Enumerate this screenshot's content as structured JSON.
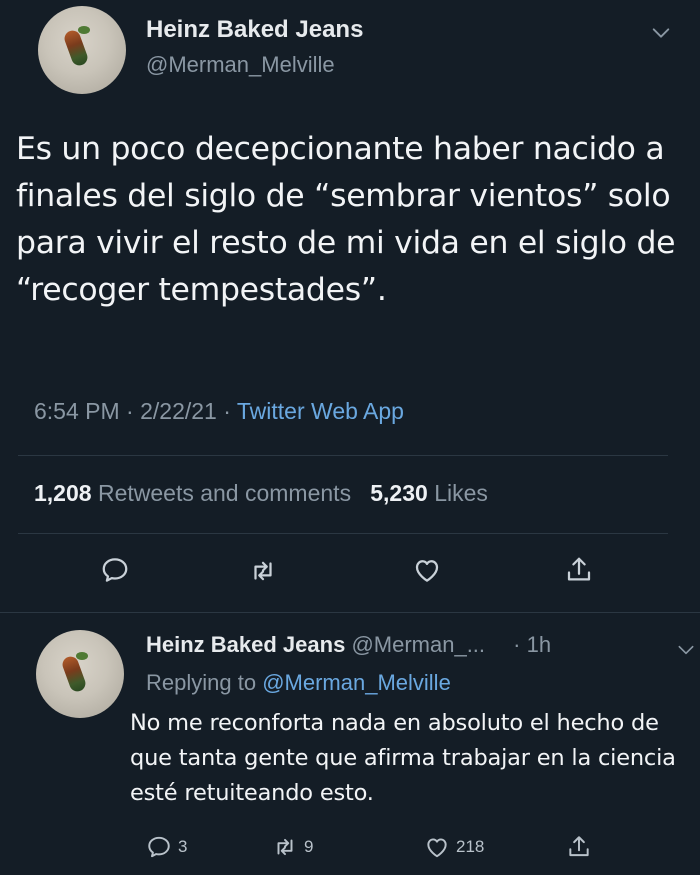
{
  "main_tweet": {
    "display_name": "Heinz Baked Jeans",
    "handle": "@Merman_Melville",
    "text": "Es un poco decepcionante haber nacido a finales del siglo de “sembrar vientos” solo para vivir el resto de mi vida en el siglo de “recoger tempestades”.",
    "time": "6:54 PM",
    "date": "2/22/21",
    "separator": "·",
    "source": "Twitter Web App",
    "retweets_count": "1,208",
    "retweets_label": "Retweets and comments",
    "likes_count": "5,230",
    "likes_label": "Likes",
    "icons": [
      "reply-icon",
      "retweet-icon",
      "like-icon",
      "share-icon"
    ]
  },
  "reply_tweet": {
    "display_name": "Heinz Baked Jeans",
    "handle": "@Merman_...",
    "age": "· 1h",
    "replying_prefix": "Replying to",
    "replying_to": "@Merman_Melville",
    "text": "No me reconforta nada en absoluto el hecho de que tanta gente que afirma trabajar en la ciencia esté retuiteando esto.",
    "reply_count": "3",
    "retweet_count": "9",
    "like_count": "218"
  },
  "colors": {
    "background": "#141d26",
    "link": "#6aa8e0",
    "muted": "#8a97a3"
  }
}
